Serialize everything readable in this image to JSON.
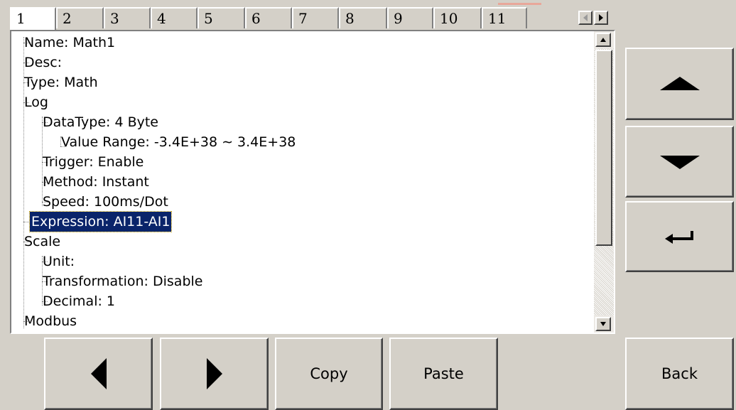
{
  "tabs": {
    "items": [
      "1",
      "2",
      "3",
      "4",
      "5",
      "6",
      "7",
      "8",
      "9",
      "10",
      "11"
    ],
    "active_index": 0
  },
  "tree": {
    "rows": [
      {
        "label": "Name: Math1"
      },
      {
        "label": "Desc:"
      },
      {
        "label": "Type: Math"
      },
      {
        "label": "Log"
      },
      {
        "label": "DataType: 4 Byte"
      },
      {
        "label": "Value Range: -3.4E+38  ∼ 3.4E+38"
      },
      {
        "label": "Trigger: Enable"
      },
      {
        "label": "Method: Instant"
      },
      {
        "label": "Speed: 100ms/Dot"
      },
      {
        "label": "Expression: AI11-AI1",
        "selected": true
      },
      {
        "label": "Scale"
      },
      {
        "label": "Unit:"
      },
      {
        "label": "Transformation: Disable"
      },
      {
        "label": "Decimal: 1"
      },
      {
        "label": "Modbus"
      }
    ]
  },
  "buttons": {
    "copy": "Copy",
    "paste": "Paste",
    "back": "Back"
  },
  "icons": {
    "up": "up-arrow-icon",
    "down": "down-arrow-icon",
    "enter": "enter-icon",
    "left": "left-arrow-icon",
    "right": "right-arrow-icon"
  },
  "colors": {
    "selection": "#0a246a",
    "background": "#d4d0c8"
  }
}
